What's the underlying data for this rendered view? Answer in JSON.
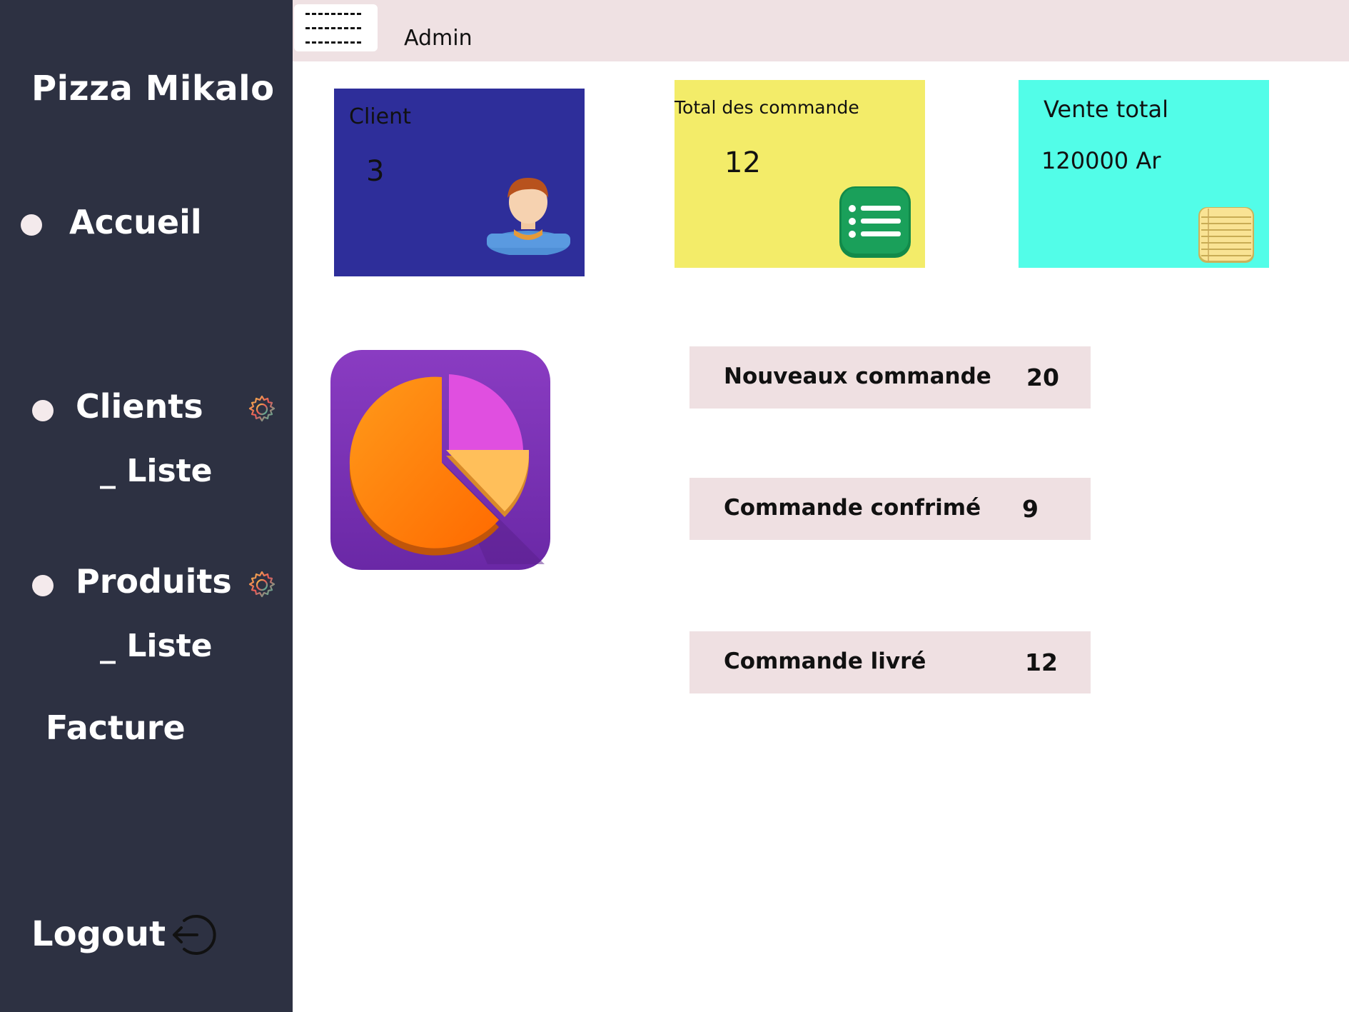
{
  "sidebar": {
    "brand": "Pizza Mikalo",
    "accueil": "Accueil",
    "clients": "Clients",
    "clients_sub": "_ Liste",
    "produits": "Produits",
    "produits_sub": "_ Liste",
    "facture": "Facture",
    "logout": "Logout"
  },
  "topbar": {
    "menu_lines": [
      "--------",
      "--------",
      "--------"
    ],
    "user": "Admin"
  },
  "cards": {
    "client": {
      "title": "Client",
      "value": "3",
      "color": "#2e2e9a",
      "icon": "user-avatar-icon"
    },
    "orders": {
      "title": "Total des commande",
      "value": "12",
      "color": "#f3ec69",
      "icon": "list-icon"
    },
    "sales": {
      "title": "Vente total",
      "value": "120000 Ar",
      "color": "#52fde8",
      "icon": "notepad-icon"
    }
  },
  "stats": [
    {
      "label": "Nouveaux commande",
      "value": "20"
    },
    {
      "label": "Commande confrimé",
      "value": "9"
    },
    {
      "label": "Commande livré",
      "value": "12"
    }
  ],
  "colors": {
    "sidebar_bg": "#2d3142",
    "topbar_bg": "#efe1e3",
    "stat_bg": "#efe0e2",
    "pie_tile": "#7a34b8"
  }
}
